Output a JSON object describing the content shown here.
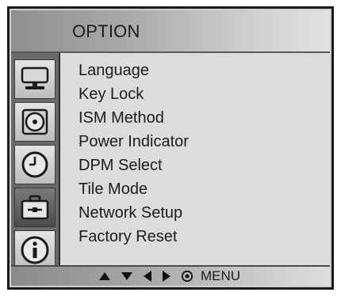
{
  "header": {
    "title": "OPTION"
  },
  "tabs": [
    {
      "icon": "monitor-icon",
      "selected": false
    },
    {
      "icon": "disc-icon",
      "selected": false
    },
    {
      "icon": "clock-icon",
      "selected": false
    },
    {
      "icon": "toolbox-icon",
      "selected": true
    },
    {
      "icon": "info-icon",
      "selected": false
    }
  ],
  "menu": {
    "items": [
      "Language",
      "Key Lock",
      "ISM Method",
      "Power Indicator",
      "DPM Select",
      "Tile Mode",
      "Network Setup",
      "Factory Reset"
    ]
  },
  "nav": {
    "icons": [
      "up-arrow-icon",
      "down-arrow-icon",
      "left-arrow-icon",
      "right-arrow-icon",
      "select-icon"
    ],
    "menu_label": "MENU"
  },
  "colors": {
    "frame": "#1a1a1a",
    "panel": "#dcdcdc",
    "icon_column": "#6a6a6a",
    "text": "#1c1c1c"
  }
}
